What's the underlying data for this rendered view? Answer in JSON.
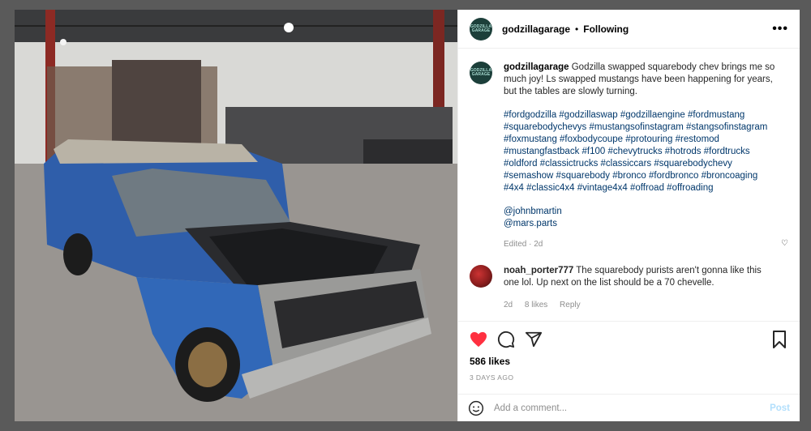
{
  "post": {
    "username": "godzillagarage",
    "dot": "•",
    "follow_status": "Following",
    "more_icon": "more-horizontal-icon",
    "avatar_text": "GODZILLA GARAGE",
    "caption": {
      "username": "godzillagarage",
      "text": "Godzilla swapped squarebody chev brings me so much joy! Ls swapped mustangs have been happening for years, but the tables are slowly turning.",
      "hashtags": "#fordgodzilla #godzillaswap #godzillaengine #fordmustang #squarebodychevys #mustangsofinstagram #stangsofinstagram #foxmustang #foxbodycoupe #protouring #restomod #mustangfastback #f100 #chevytrucks #hotrods #fordtrucks #oldford #classictrucks #classiccars #squarebodychevy #semashow #squarebody #bronco #fordbronco #broncoaging #4x4 #classic4x4 #vintage4x4 #offroad #offroading",
      "mention1": "@johnbmartin",
      "mention2": "@mars.parts",
      "edited": "Edited · 2d"
    },
    "comment": {
      "username": "noah_porter777",
      "text": "The squarebody purists aren't gonna like this one lol. Up next on the list should be a 70 chevelle.",
      "age": "2d",
      "likes": "8 likes",
      "reply": "Reply"
    },
    "likes": "586 likes",
    "time_ago": "3 DAYS AGO",
    "add_comment_placeholder": "Add a comment...",
    "post_label": "Post",
    "colors": {
      "like_red": "#ff3040",
      "link_blue": "#00376b",
      "post_disabled": "#b2dffc"
    },
    "icons": [
      "heart-icon",
      "comment-icon",
      "share-icon",
      "bookmark-icon",
      "emoji-icon"
    ]
  }
}
